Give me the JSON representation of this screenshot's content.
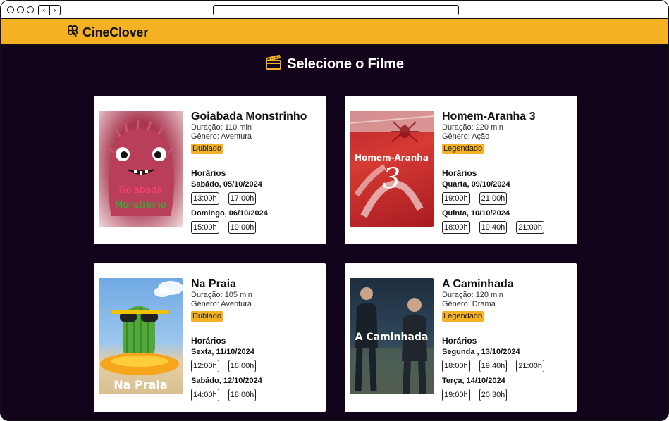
{
  "app": {
    "brand": "CineClover",
    "page_title": "Selecione o Filme"
  },
  "labels": {
    "duration_prefix": "Duração: ",
    "genre_prefix": "Gênero: ",
    "schedules": "Horários"
  },
  "colors": {
    "accent": "#f4b124",
    "background": "#12041a",
    "card": "#ffffff"
  },
  "movies": [
    {
      "title": "Goiabada Monstrinho",
      "duration": "Duração: 110 min",
      "genre": "Gênero: Aventura",
      "badge": "Dublado",
      "poster_line1": "Goiabada",
      "poster_line2": "Monstrinho",
      "days": [
        {
          "label": "Sabádo, 05/10/2024",
          "times": [
            "13:00h",
            "17:00h"
          ]
        },
        {
          "label": "Domingo, 06/10/2024",
          "times": [
            "15:00h",
            "19:00h"
          ]
        }
      ]
    },
    {
      "title": "Homem-Aranha 3",
      "duration": "Duração: 220 min",
      "genre": "Gênero: Ação",
      "badge": "Legendado",
      "poster_line1": "Homem-Aranha",
      "poster_line2": "3",
      "days": [
        {
          "label": "Quarta, 09/10/2024",
          "times": [
            "19:00h",
            "21:00h"
          ]
        },
        {
          "label": "Quinta, 10/10/2024",
          "times": [
            "18:00h",
            "19:40h",
            "21:00h"
          ]
        }
      ]
    },
    {
      "title": "Na Praia",
      "duration": "Duração: 105 min",
      "genre": "Gênero: Aventura",
      "badge": "Dublado",
      "poster_line1": "Na Praia",
      "days": [
        {
          "label": "Sexta, 11/10/2024",
          "times": [
            "12:00h",
            "16:00h"
          ]
        },
        {
          "label": "Sabádo, 12/10/2024",
          "times": [
            "14:00h",
            "18:00h"
          ]
        }
      ]
    },
    {
      "title": "A Caminhada",
      "duration": "Duração: 120 min",
      "genre": "Gênero: Drama",
      "badge": "Legendado",
      "poster_line1": "A Caminhada",
      "days": [
        {
          "label": "Segunda , 13/10/2024",
          "times": [
            "18:00h",
            "19:40h",
            "21:00h"
          ]
        },
        {
          "label": "Terça, 14/10/2024",
          "times": [
            "19:00h",
            "20:30h"
          ]
        }
      ]
    }
  ]
}
